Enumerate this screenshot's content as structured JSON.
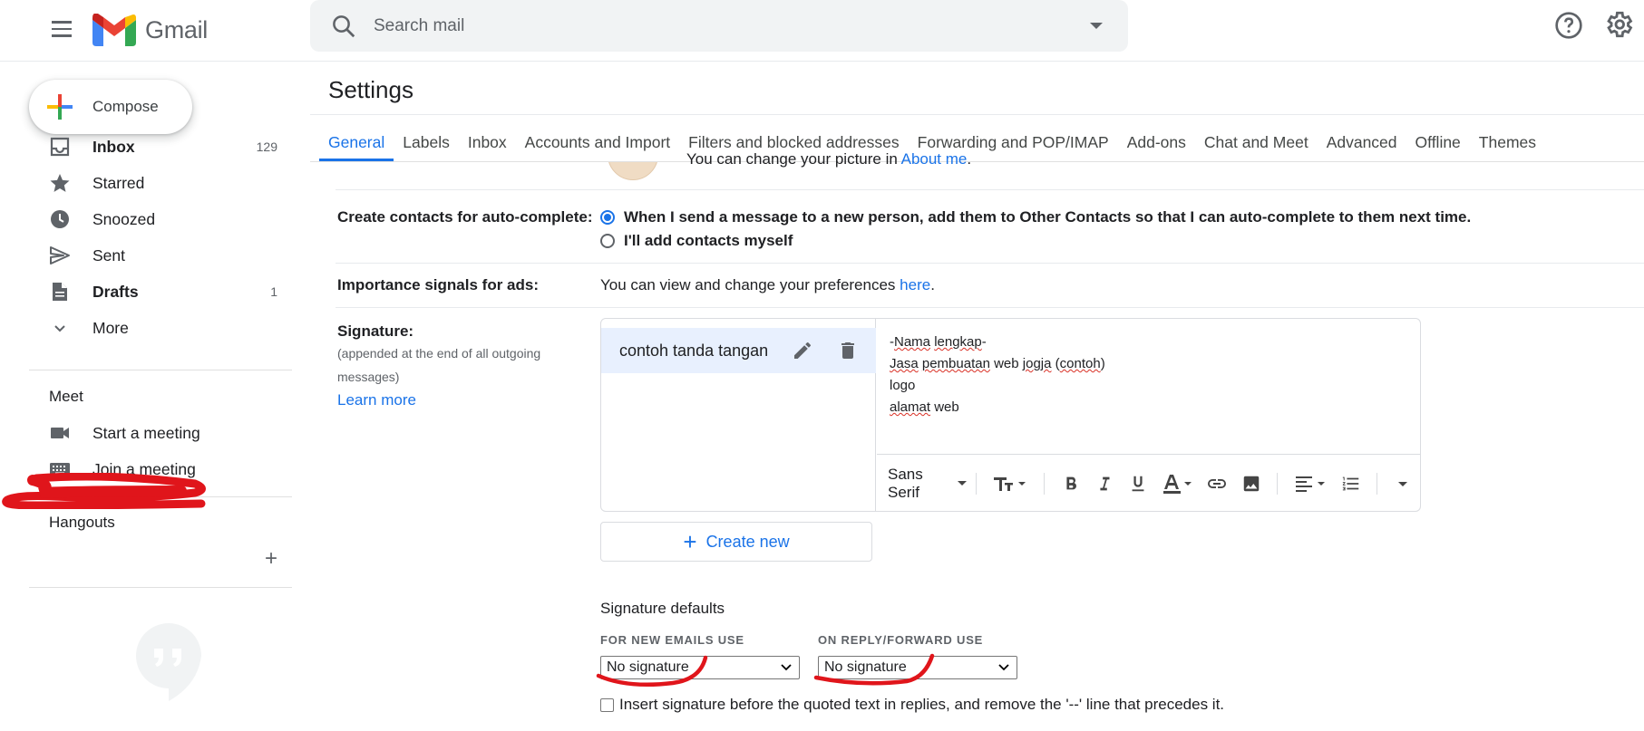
{
  "app": {
    "logo_text": "Gmail"
  },
  "search": {
    "placeholder": "Search mail"
  },
  "compose": {
    "label": "Compose"
  },
  "nav": {
    "items": [
      {
        "label": "Inbox",
        "count": "129",
        "icon": "inbox-icon"
      },
      {
        "label": "Starred",
        "count": "",
        "icon": "star-icon"
      },
      {
        "label": "Snoozed",
        "count": "",
        "icon": "clock-icon"
      },
      {
        "label": "Sent",
        "count": "",
        "icon": "send-icon"
      },
      {
        "label": "Drafts",
        "count": "1",
        "icon": "draft-icon"
      },
      {
        "label": "More",
        "count": "",
        "icon": "chevron-down-icon"
      }
    ]
  },
  "meet": {
    "title": "Meet",
    "start": "Start a meeting",
    "join": "Join a meeting"
  },
  "hangouts": {
    "title": "Hangouts"
  },
  "settings": {
    "title": "Settings",
    "tabs": [
      "General",
      "Labels",
      "Inbox",
      "Accounts and Import",
      "Filters and blocked addresses",
      "Forwarding and POP/IMAP",
      "Add-ons",
      "Chat and Meet",
      "Advanced",
      "Offline",
      "Themes"
    ],
    "picture": {
      "text": "You can change your picture in ",
      "link": "About me",
      "end": "."
    },
    "contacts": {
      "label": "Create contacts for auto-complete:",
      "opt1": "When I send a message to a new person, add them to Other Contacts so that I can auto-complete to them next time.",
      "opt2": "I'll add contacts myself"
    },
    "ads": {
      "label": "Importance signals for ads:",
      "text": "You can view and change your preferences ",
      "link": "here",
      "end": "."
    },
    "signature": {
      "label": "Signature:",
      "note": "(appended at the end of all outgoing messages)",
      "learn": "Learn more",
      "name": "contoh tanda tangan",
      "lines": {
        "l1a": "-",
        "l1b": "Nama",
        "l1c": " ",
        "l1d": "lengkap",
        "l1e": "-",
        "l2a": "Jasa",
        "l2b": " ",
        "l2c": "pembuatan",
        "l2d": " web ",
        "l2e": "jogja",
        "l2f": " (",
        "l2g": "contoh",
        "l2h": ")",
        "l3": "logo",
        "l4a": "alamat",
        "l4b": " web"
      },
      "font": "Sans Serif",
      "create_new": "Create new"
    },
    "defaults": {
      "title": "Signature defaults",
      "new_label": "FOR NEW EMAILS USE",
      "reply_label": "ON REPLY/FORWARD USE",
      "new_value": "No signature",
      "reply_value": "No signature",
      "checkbox": "Insert signature before the quoted text in replies, and remove the '--' line that precedes it."
    }
  },
  "colors": {
    "accent": "#1a73e8",
    "annotation": "#e0151b"
  }
}
